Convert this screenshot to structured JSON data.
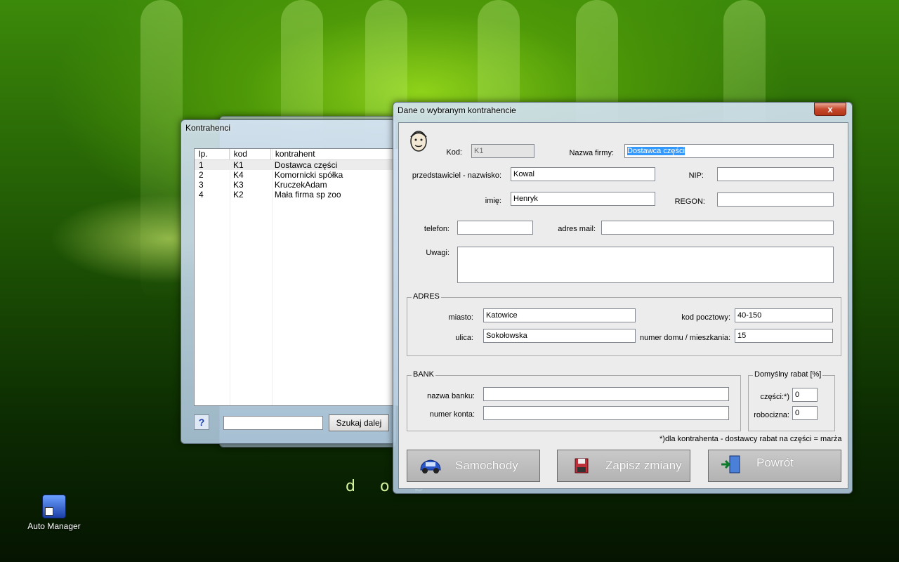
{
  "desktop": {
    "background_text": "d o b",
    "icons": [
      {
        "label": "Auto Manager",
        "icon": "car-app-icon"
      }
    ]
  },
  "back_window": {
    "title": "Kontrahenci",
    "columns": [
      "lp.",
      "kod",
      "kontrahent"
    ],
    "rows": [
      {
        "lp": "1",
        "kod": "K1",
        "kontrahent": "Dostawca części"
      },
      {
        "lp": "2",
        "kod": "K4",
        "kontrahent": "Komornicki spółka"
      },
      {
        "lp": "3",
        "kod": "K3",
        "kontrahent": "KruczekAdam"
      },
      {
        "lp": "4",
        "kod": "K2",
        "kontrahent": "Mała firma sp zoo"
      }
    ],
    "help_label": "?",
    "search_value": "",
    "search_button": "Szukaj dalej"
  },
  "dialog": {
    "title": "Dane o wybranym kontrahencie",
    "close_label": "x",
    "fields": {
      "kod_label": "Kod:",
      "kod_value": "K1",
      "nazwa_label": "Nazwa firmy:",
      "nazwa_value": "Dostawca części",
      "nazwisko_label": "przedstawiciel - nazwisko:",
      "nazwisko_value": "Kowal",
      "nip_label": "NIP:",
      "nip_value": "",
      "imie_label": "imię:",
      "imie_value": "Henryk",
      "regon_label": "REGON:",
      "regon_value": "",
      "telefon_label": "telefon:",
      "telefon_value": "",
      "mail_label": "adres mail:",
      "mail_value": "",
      "uwagi_label": "Uwagi:",
      "uwagi_value": ""
    },
    "adres": {
      "legend": "ADRES",
      "miasto_label": "miasto:",
      "miasto_value": "Katowice",
      "ulica_label": "ulica:",
      "ulica_value": "Sokołowska",
      "kod_label": "kod pocztowy:",
      "kod_value": "40-150",
      "numer_label": "numer domu / mieszkania:",
      "numer_value": "15"
    },
    "bank": {
      "legend": "BANK",
      "nazwa_label": "nazwa banku:",
      "nazwa_value": "",
      "konto_label": "numer konta:",
      "konto_value": ""
    },
    "rabat": {
      "legend": "Domyślny rabat [%]",
      "czesci_label": "części:*)",
      "czesci_value": "0",
      "robocizna_label": "robocizna:",
      "robocizna_value": "0"
    },
    "footnote": "*)dla kontrahenta - dostawcy rabat na części = marża",
    "buttons": {
      "samochody": "Samochody",
      "zapisz": "Zapisz zmiany",
      "powrot": "Powrót"
    }
  }
}
